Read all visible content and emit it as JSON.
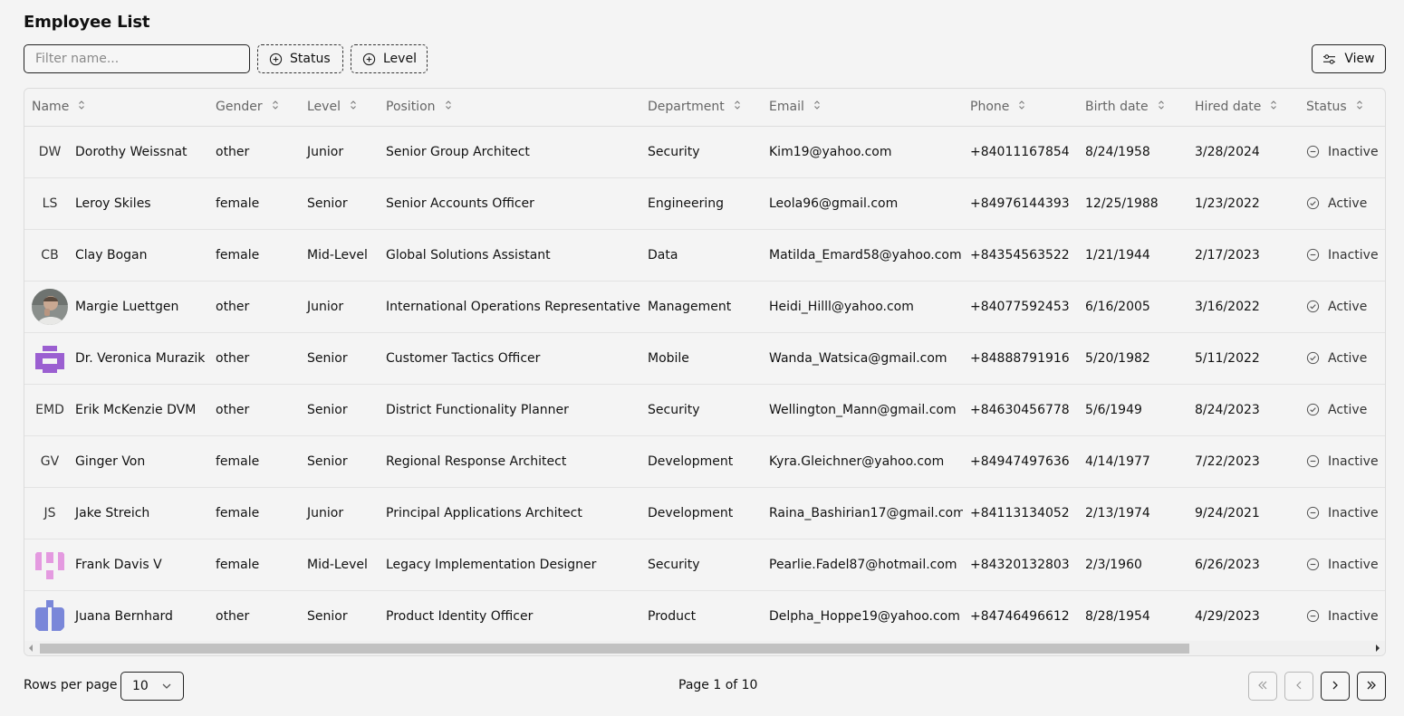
{
  "page": {
    "title": "Employee List"
  },
  "toolbar": {
    "filter_placeholder": "Filter name...",
    "status_label": "Status",
    "level_label": "Level",
    "view_label": "View"
  },
  "table": {
    "headers": [
      "Name",
      "Gender",
      "Level",
      "Position",
      "Department",
      "Email",
      "Phone",
      "Birth date",
      "Hired date",
      "Status"
    ],
    "rows": [
      {
        "initials": "DW",
        "avatar": "initials",
        "name": "Dorothy Weissnat",
        "gender": "other",
        "level": "Junior",
        "position": "Senior Group Architect",
        "department": "Security",
        "email": "Kim19@yahoo.com",
        "phone": "+84011167854",
        "birth": "8/24/1958",
        "hired": "3/28/2024",
        "status": "Inactive"
      },
      {
        "initials": "LS",
        "avatar": "initials",
        "name": "Leroy Skiles",
        "gender": "female",
        "level": "Senior",
        "position": "Senior Accounts Officer",
        "department": "Engineering",
        "email": "Leola96@gmail.com",
        "phone": "+84976144393",
        "birth": "12/25/1988",
        "hired": "1/23/2022",
        "status": "Active"
      },
      {
        "initials": "CB",
        "avatar": "initials",
        "name": "Clay Bogan",
        "gender": "female",
        "level": "Mid-Level",
        "position": "Global Solutions Assistant",
        "department": "Data",
        "email": "Matilda_Emard58@yahoo.com",
        "phone": "+84354563522",
        "birth": "1/21/1944",
        "hired": "2/17/2023",
        "status": "Inactive"
      },
      {
        "initials": "",
        "avatar": "photo",
        "name": "Margie Luettgen",
        "gender": "other",
        "level": "Junior",
        "position": "International Operations Representative",
        "department": "Management",
        "email": "Heidi_Hilll@yahoo.com",
        "phone": "+84077592453",
        "birth": "6/16/2005",
        "hired": "3/16/2022",
        "status": "Active"
      },
      {
        "initials": "",
        "avatar": "pixel-purple",
        "name": "Dr. Veronica Murazik",
        "gender": "other",
        "level": "Senior",
        "position": "Customer Tactics Officer",
        "department": "Mobile",
        "email": "Wanda_Watsica@gmail.com",
        "phone": "+84888791916",
        "birth": "5/20/1982",
        "hired": "5/11/2022",
        "status": "Active"
      },
      {
        "initials": "EMD",
        "avatar": "initials",
        "name": "Erik McKenzie DVM",
        "gender": "other",
        "level": "Senior",
        "position": "District Functionality Planner",
        "department": "Security",
        "email": "Wellington_Mann@gmail.com",
        "phone": "+84630456778",
        "birth": "5/6/1949",
        "hired": "8/24/2023",
        "status": "Active"
      },
      {
        "initials": "GV",
        "avatar": "initials",
        "name": "Ginger Von",
        "gender": "female",
        "level": "Senior",
        "position": "Regional Response Architect",
        "department": "Development",
        "email": "Kyra.Gleichner@yahoo.com",
        "phone": "+84947497636",
        "birth": "4/14/1977",
        "hired": "7/22/2023",
        "status": "Inactive"
      },
      {
        "initials": "JS",
        "avatar": "initials",
        "name": "Jake Streich",
        "gender": "female",
        "level": "Junior",
        "position": "Principal Applications Architect",
        "department": "Development",
        "email": "Raina_Bashirian17@gmail.com",
        "phone": "+84113134052",
        "birth": "2/13/1974",
        "hired": "9/24/2021",
        "status": "Inactive"
      },
      {
        "initials": "",
        "avatar": "pixel-pink",
        "name": "Frank Davis V",
        "gender": "female",
        "level": "Mid-Level",
        "position": "Legacy Implementation Designer",
        "department": "Security",
        "email": "Pearlie.Fadel87@hotmail.com",
        "phone": "+84320132803",
        "birth": "2/3/1960",
        "hired": "6/26/2023",
        "status": "Inactive"
      },
      {
        "initials": "",
        "avatar": "pixel-blue",
        "name": "Juana Bernhard",
        "gender": "other",
        "level": "Senior",
        "position": "Product Identity Officer",
        "department": "Product",
        "email": "Delpha_Hoppe19@yahoo.com",
        "phone": "+84746496612",
        "birth": "8/28/1954",
        "hired": "4/29/2023",
        "status": "Inactive"
      }
    ]
  },
  "footer": {
    "rows_label": "Rows per page",
    "rows_value": "10",
    "page_info": "Page 1 of 10"
  },
  "colors": {
    "background": "#f4f4f4",
    "avatar_purple": "#9b5fd1",
    "avatar_pink": "#e49ae0",
    "avatar_blue": "#7a87d9"
  }
}
